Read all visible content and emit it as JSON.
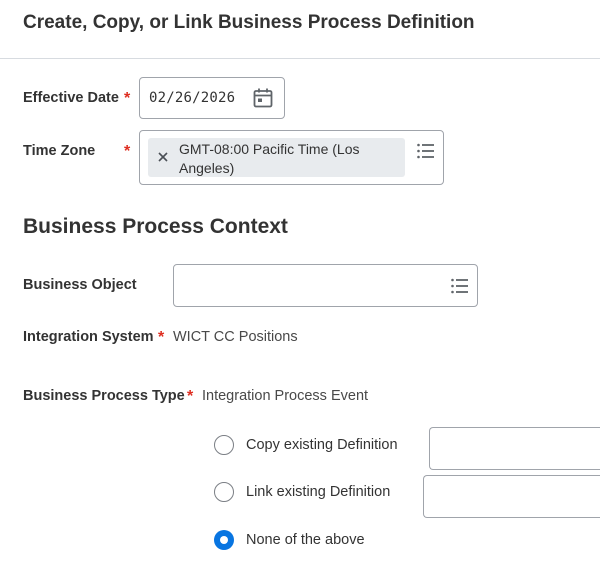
{
  "page": {
    "title": "Create, Copy, or Link Business Process Definition"
  },
  "effective_date": {
    "label": "Effective Date",
    "required": "*",
    "value": "02/26/2026"
  },
  "time_zone": {
    "label": "Time Zone",
    "required": "*",
    "selected": "GMT-08:00 Pacific Time (Los Angeles)"
  },
  "context": {
    "heading": "Business Process Context",
    "business_object": {
      "label": "Business Object",
      "value": ""
    },
    "integration_system": {
      "label": "Integration System",
      "required": "*",
      "value": "WICT CC Positions"
    },
    "business_process_type": {
      "label": "Business Process Type",
      "required": "*",
      "value": "Integration Process Event"
    }
  },
  "options": [
    {
      "label": "Copy existing Definition",
      "selected": false
    },
    {
      "label": "Link existing Definition",
      "selected": false
    },
    {
      "label": "None of the above",
      "selected": true
    }
  ],
  "colors": {
    "required": "#de2e21",
    "radio_selected": "#0875e1",
    "field_border": "#a0a4ab",
    "pill_background": "#e8ebee"
  },
  "icons": {
    "calendar": "calendar-icon",
    "remove": "close-icon",
    "prompt": "list-icon"
  }
}
